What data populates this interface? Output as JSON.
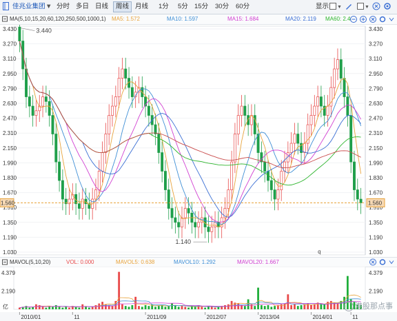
{
  "toolbar": {
    "stock_name": "佳兆业集团",
    "periods": [
      "分时",
      "多日",
      "日线",
      "周线",
      "月线",
      "1分",
      "5分",
      "15分",
      "30分",
      "60分"
    ],
    "active_period": "周线",
    "display_label": "显示",
    "aa_label": "Aa"
  },
  "ma": {
    "label": "MA(5,10,15,20,60,120,250,500,1000,1)",
    "items": [
      {
        "name": "MA5:",
        "value": "1.572",
        "color": "#e8a33b"
      },
      {
        "name": "MA10:",
        "value": "1.597",
        "color": "#3f8fd6"
      },
      {
        "name": "MA15:",
        "value": "1.684",
        "color": "#d13fd1"
      },
      {
        "name": "MA20:",
        "value": "2.119",
        "color": "#3b6fd4"
      },
      {
        "name": "MA60:",
        "value": "2.4",
        "color": "#2db52d"
      }
    ]
  },
  "price_axis": [
    "3.430",
    "3.270",
    "3.110",
    "2.950",
    "2.790",
    "2.630",
    "2.470",
    "2.310",
    "2.150",
    "1.990",
    "1.830",
    "1.670",
    "1.510",
    "1.350",
    "1.190",
    "1.030"
  ],
  "current_price": "1.560",
  "annotations": {
    "high": "3.440",
    "low": "1.140",
    "q": "q"
  },
  "vol": {
    "label": "MAVOL(5,10,20)",
    "items": [
      {
        "name": "VOL:",
        "value": "0.000",
        "color": "#e84a4a"
      },
      {
        "name": "MAVOL5:",
        "value": "0.638",
        "color": "#e8a33b"
      },
      {
        "name": "MAVOL10:",
        "value": "1.292",
        "color": "#3f8fd6"
      },
      {
        "name": "MAVOL20:",
        "value": "1.667",
        "color": "#d13fd1"
      }
    ],
    "axis": [
      "4.379",
      "2.190"
    ],
    "unit": "亿"
  },
  "time_axis": [
    "2010/01",
    "11",
    "2011/09",
    "2012/07",
    "2013/04",
    "2014/01",
    "11"
  ],
  "watermark": "港股那点事",
  "chart_data": {
    "type": "candlestick",
    "ylim": [
      1.03,
      3.43
    ],
    "high_marker": 3.44,
    "low_marker": 1.14,
    "current": 1.56,
    "close": [
      3.3,
      3.0,
      2.7,
      2.6,
      2.5,
      2.55,
      2.6,
      2.7,
      2.65,
      2.5,
      2.3,
      2.0,
      1.8,
      1.6,
      1.55,
      1.6,
      1.65,
      1.55,
      1.5,
      1.6,
      1.55,
      1.5,
      1.6,
      1.7,
      1.9,
      2.1,
      2.3,
      2.5,
      2.6,
      2.7,
      2.9,
      3.0,
      2.9,
      2.8,
      2.7,
      2.75,
      2.8,
      2.7,
      2.6,
      2.5,
      2.4,
      2.3,
      2.1,
      1.9,
      1.7,
      1.5,
      1.4,
      1.35,
      1.3,
      1.4,
      1.5,
      1.45,
      1.35,
      1.3,
      1.35,
      1.4,
      1.3,
      1.25,
      1.3,
      1.35,
      1.3,
      1.4,
      1.5,
      1.7,
      2.0,
      2.3,
      2.5,
      2.6,
      2.5,
      2.4,
      2.5,
      2.3,
      2.1,
      2.0,
      1.9,
      1.8,
      1.7,
      1.6,
      1.7,
      1.9,
      2.0,
      2.1,
      2.2,
      2.3,
      2.2,
      2.1,
      2.2,
      2.4,
      2.5,
      2.6,
      2.7,
      2.6,
      2.5,
      2.6,
      2.8,
      3.0,
      3.1,
      2.9,
      2.7,
      2.5,
      2.0,
      1.7,
      1.6,
      1.56
    ],
    "volume": [
      0.2,
      0.3,
      0.4,
      0.2,
      0.3,
      0.6,
      0.5,
      0.3,
      0.2,
      0.4,
      0.3,
      0.5,
      0.3,
      0.2,
      0.3,
      0.2,
      0.4,
      0.3,
      0.2,
      0.6,
      0.3,
      0.2,
      0.3,
      0.5,
      0.7,
      0.9,
      0.6,
      0.5,
      0.4,
      1.0,
      4.5,
      0.6,
      0.4,
      0.3,
      0.5,
      1.5,
      0.4,
      0.3,
      0.5,
      0.4,
      0.6,
      0.3,
      0.4,
      0.5,
      0.3,
      0.4,
      0.7,
      0.5,
      0.3,
      0.4,
      0.3,
      0.2,
      0.4,
      0.3,
      0.5,
      0.3,
      0.2,
      0.4,
      0.3,
      0.2,
      0.3,
      0.4,
      0.5,
      0.6,
      1.0,
      0.8,
      0.7,
      0.5,
      0.4,
      1.2,
      0.6,
      0.4,
      2.6,
      0.5,
      0.4,
      0.5,
      0.3,
      0.4,
      0.5,
      0.6,
      0.7,
      1.8,
      0.5,
      0.6,
      0.4,
      0.5,
      0.6,
      0.7,
      0.5,
      0.6,
      0.8,
      0.7,
      0.6,
      0.9,
      1.0,
      0.8,
      0.7,
      1.0,
      1.5,
      4.0,
      1.2,
      0.9,
      0.6,
      0.5
    ]
  }
}
